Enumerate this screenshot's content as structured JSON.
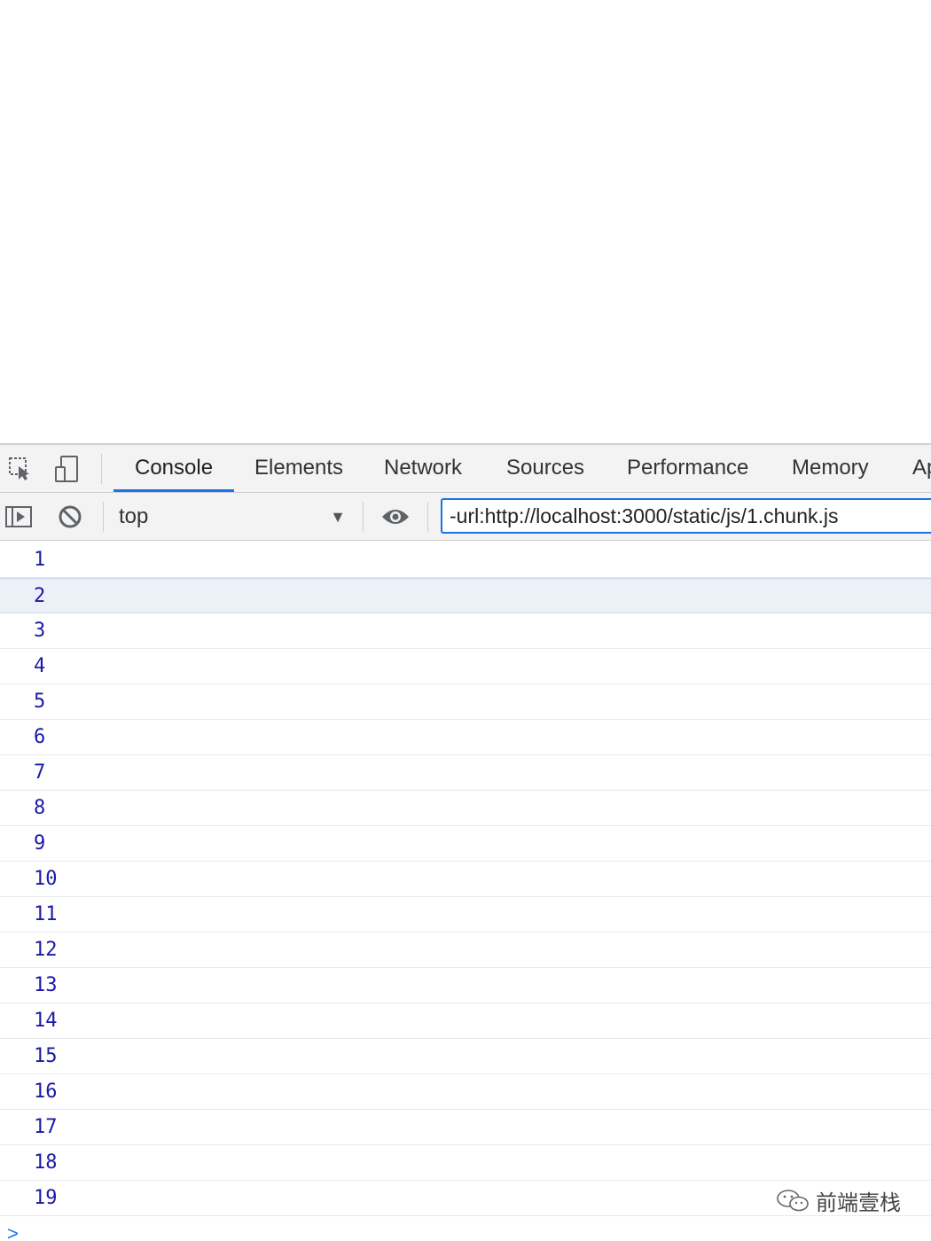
{
  "devtools": {
    "tabs": [
      {
        "label": "Console",
        "active": true
      },
      {
        "label": "Elements"
      },
      {
        "label": "Network"
      },
      {
        "label": "Sources"
      },
      {
        "label": "Performance"
      },
      {
        "label": "Memory"
      },
      {
        "label": "Ap"
      }
    ],
    "icons": {
      "inspect": "inspect-element-icon",
      "device": "device-toolbar-icon",
      "sidebar": "show-sidebar-icon",
      "clear": "clear-console-icon",
      "eye": "live-expression-icon"
    },
    "accent_color": "#1a73e8"
  },
  "filterbar": {
    "context": "top",
    "filter_value": "-url:http://localhost:3000/static/js/1.chunk.js"
  },
  "console": {
    "messages": [
      "1",
      "2",
      "3",
      "4",
      "5",
      "6",
      "7",
      "8",
      "9",
      "10",
      "11",
      "12",
      "13",
      "14",
      "15",
      "16",
      "17",
      "18",
      "19"
    ],
    "selected_index": 1,
    "message_color": "#1a1aa6",
    "prompt_symbol": ">"
  },
  "watermark": {
    "text": "前端壹栈"
  }
}
